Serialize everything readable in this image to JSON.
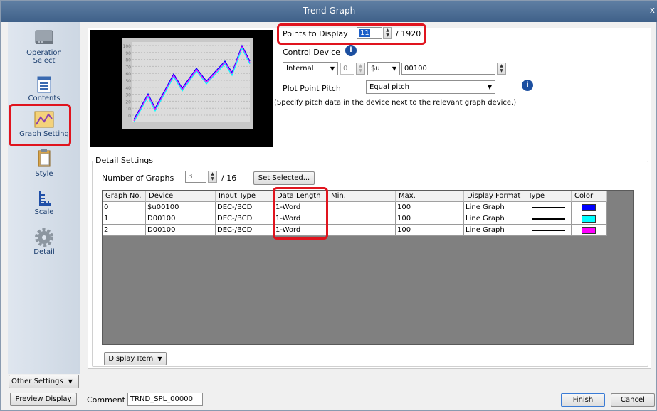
{
  "window": {
    "title": "Trend Graph",
    "close_label": "x"
  },
  "sidebar": {
    "items": [
      {
        "label": "Operation Select",
        "icon": "device-icon"
      },
      {
        "label": "Contents",
        "icon": "document-list-icon"
      },
      {
        "label": "Graph Setting",
        "icon": "graph-icon",
        "selected": true
      },
      {
        "label": "Style",
        "icon": "clipboard-icon"
      },
      {
        "label": "Scale",
        "icon": "scale-icon"
      },
      {
        "label": "Detail",
        "icon": "gear-icon"
      }
    ],
    "other_settings_label": "Other Settings"
  },
  "preview": {
    "y_ticks": [
      "100",
      "90",
      "80",
      "70",
      "60",
      "50",
      "40",
      "30",
      "20",
      "10",
      "0"
    ],
    "series_colors": [
      "#0000ff",
      "#ff00ff",
      "#00ffff"
    ]
  },
  "points_to_display": {
    "label": "Points to Display",
    "value": "11",
    "max": "/ 1920"
  },
  "control_device": {
    "label": "Control Device",
    "type_select": "Internal",
    "number_value": "0",
    "device_select": "$u",
    "address_value": "00100"
  },
  "plot_point_pitch": {
    "label": "Plot Point Pitch",
    "select_value": "Equal pitch",
    "note": "(Specify pitch data in the device next to the relevant graph device.)"
  },
  "detail_settings": {
    "group_label": "Detail Settings",
    "number_of_graphs_label": "Number of Graphs",
    "number_of_graphs_value": "3",
    "number_of_graphs_max": "/ 16",
    "set_selected_label": "Set Selected..."
  },
  "table": {
    "headers": [
      "Graph No.",
      "Device",
      "Input Type",
      "Data Length",
      "Min.",
      "Max.",
      "Display Format",
      "Type",
      "Color"
    ],
    "rows": [
      {
        "no": "0",
        "device": "$u00100",
        "input_type": "DEC-/BCD",
        "data_length": "1-Word",
        "min": "",
        "max": "100",
        "display_format": "Line Graph",
        "color": "#0000ff"
      },
      {
        "no": "1",
        "device": "D00100",
        "input_type": "DEC-/BCD",
        "data_length": "1-Word",
        "min": "",
        "max": "100",
        "display_format": "Line Graph",
        "color": "#00ffff"
      },
      {
        "no": "2",
        "device": "D00100",
        "input_type": "DEC-/BCD",
        "data_length": "1-Word",
        "min": "",
        "max": "100",
        "display_format": "Line Graph",
        "color": "#ff00ff"
      }
    ]
  },
  "display_item_label": "Display Item",
  "footer": {
    "preview_display_label": "Preview Display",
    "comment_label": "Comment",
    "comment_value": "TRND_SPL_00000",
    "finish_label": "Finish",
    "cancel_label": "Cancel"
  },
  "highlight_color": "#e0141e"
}
